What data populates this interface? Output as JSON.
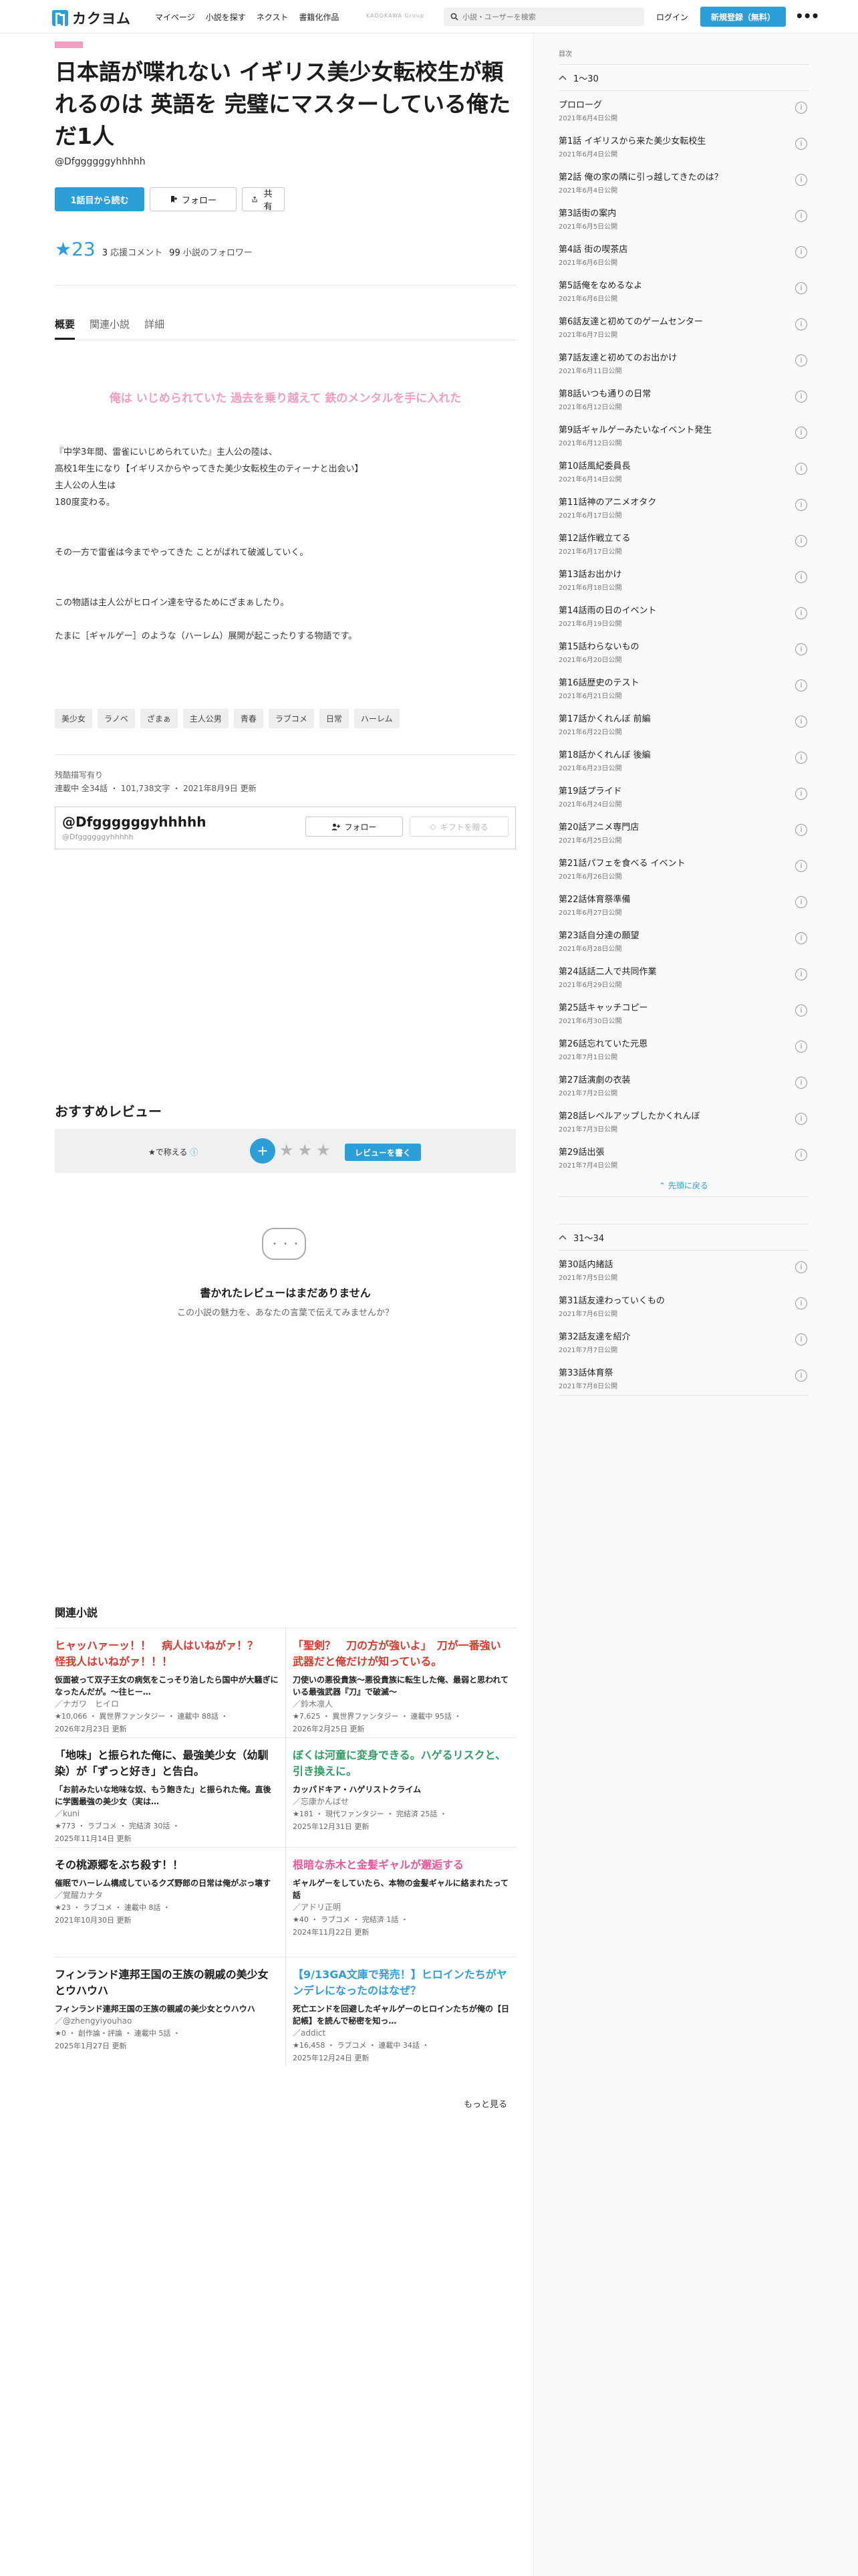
{
  "header": {
    "logo": "カクヨム",
    "nav": [
      "マイページ",
      "小説を探す",
      "ネクスト",
      "書籍化作品"
    ],
    "kadokawa": "KADOKAWA Group",
    "search_placeholder": "小説・ユーザーを検索",
    "login": "ログイン",
    "signup": "新規登録（無料）",
    "more": "•••"
  },
  "work": {
    "title": "日本語が喋れない イギリス美少女転校生が頼れるのは 英語を 完璧にマスターしている俺ただ1人",
    "author": "@Dfggggggyhhhhh",
    "read_button": "1話目から読む",
    "follow_button": "フォロー",
    "share_button": "共有",
    "stars": "★23",
    "comments": "3",
    "comments_label": "応援コメント",
    "followers": "99",
    "followers_label": "小説のフォロワー"
  },
  "tabs": [
    "概要",
    "関連小説",
    "詳細"
  ],
  "catchphrase": "俺は いじめられていた 過去を乗り越えて 鉄のメンタルを手に入れた",
  "introduction": "『中学3年間、雷雀にいじめられていた』主人公の陸は、\n高校1年生になり【イギリスからやってきた美少女転校生のティーナと出会い】\n主人公の人生は\n180度変わる。\n\n\nその一方で雷雀は今までやってきた ことがばれて破滅していく。\n\n\nこの物語は主人公がヒロイン達を守るためにざまぁしたり。\n\nたまに［ギャルゲー］のような（ハーレム）展開が起こったりする物語です。",
  "tags": [
    "美少女",
    "ラノベ",
    "ざまぁ",
    "主人公男",
    "青春",
    "ラブコメ",
    "日常",
    "ハーレム"
  ],
  "meta": {
    "rating_note": "残酷描写有り",
    "status": "連載中 全34話 ・ 101,738文字 ・ 2021年8月9日 更新"
  },
  "author_card": {
    "name": "@Dfggggggyhhhhh",
    "handle": "@Dfggggggyhhhhh",
    "follow": "フォロー",
    "gift": "ギフトを贈る"
  },
  "reviews": {
    "title": "おすすめレビュー",
    "rate_label": "★で称える",
    "plus": "+",
    "stars": [
      "★",
      "★",
      "★"
    ],
    "write": "レビューを書く",
    "empty_title": "書かれたレビューはまだありません",
    "empty_sub": "この小説の魅力を、あなたの言葉で伝えてみませんか？"
  },
  "related": {
    "title": "関連小説",
    "items": [
      {
        "title": "ヒャッハァーッ！！　病人はいねがァ！？　怪我人はいねがァ！！！",
        "color": "#e0352b",
        "desc": "仮面被って双子王女の病気をこっそり治したら国中が大騒ぎになったんだが。〜往ヒー…",
        "author": "／ナガワ　ヒイロ",
        "meta1": "★10,066 ・ 異世界ファンタジー ・ 連載中 88話 ・",
        "meta2": "2026年2月23日 更新"
      },
      {
        "title": "「聖剣？　刀の方が強いよ」　刀が一番強い武器だと俺だけが知っている。",
        "color": "#e0352b",
        "desc": "刀使いの悪役貴族〜悪役貴族に転生した俺、最弱と思われている最強武器『刀』で破滅〜",
        "author": "／鈴木凛人",
        "meta1": "★7,625 ・ 異世界ファンタジー ・ 連載中 95話 ・",
        "meta2": "2026年2月25日 更新"
      },
      {
        "title": "「地味」と振られた俺に、最強美少女（幼馴染）が「ずっと好き」と告白。",
        "color": "#1c1c1c",
        "desc": "「お前みたいな地味な奴、もう飽きた」と振られた俺。直後に学園最強の美少女（実は…",
        "author": "／kuni",
        "meta1": "★773 ・ ラブコメ ・ 完結済 30話 ・",
        "meta2": "2025年11月14日 更新"
      },
      {
        "title": "ぼくは河童に変身できる。ハゲるリスクと、引き換えに。",
        "color": "#2e9d62",
        "desc": "カッパドキア・ハゲリストクライム",
        "author": "／忘康かんばせ",
        "meta1": "★181 ・ 現代ファンタジー ・ 完結済 25話 ・",
        "meta2": "2025年12月31日 更新"
      },
      {
        "title": "その桃源郷をぶち殺す！！",
        "color": "#1c1c1c",
        "desc": "催眠でハーレム構成しているクズ野郎の日常は俺がぶっ壊す",
        "author": "／覚醒カナタ",
        "meta1": "★23 ・ ラブコメ ・ 連載中 8話 ・",
        "meta2": "2021年10月30日 更新"
      },
      {
        "title": "根暗な赤木と金髪ギャルが邂逅する",
        "color": "#e8579a",
        "desc": "ギャルゲーをしていたら、本物の金髪ギャルに絡まれたって話",
        "author": "／アドリ正明",
        "meta1": "★40 ・ ラブコメ ・ 完結済 1話 ・",
        "meta2": "2024年11月22日 更新"
      },
      {
        "title": "フィンランド連邦王国の王族の親戚の美少女とウハウハ",
        "color": "#1c1c1c",
        "desc": "フィンランド連邦王国の王族の親戚の美少女とウハウハ",
        "author": "／@zhengyiyouhao",
        "meta1": "★0 ・ 創作論・評論 ・ 連載中 5話 ・",
        "meta2": "2025年1月27日 更新"
      },
      {
        "title": "【9/13GA文庫で発売！】ヒロインたちがヤンデレになったのはなぜ？",
        "color": "#2c9fd9",
        "desc": "死亡エンドを回避したギャルゲーのヒロインたちが俺の【日記帳】を読んで秘密を知っ…",
        "author": "／addict",
        "meta1": "★16,458 ・ ラブコメ ・ 連載中 34話 ・",
        "meta2": "2025年12月24日 更新"
      }
    ],
    "more": "もっと見る"
  },
  "toc": {
    "label": "目次",
    "section1_title": "1〜30",
    "section1": [
      {
        "t": "プロローグ",
        "d": "2021年6月4日公開"
      },
      {
        "t": "第1話 イギリスから来た美少女転校生",
        "d": "2021年6月4日公開"
      },
      {
        "t": "第2話 俺の家の隣に引っ越してきたのは？",
        "d": "2021年6月4日公開"
      },
      {
        "t": "第3話街の案内",
        "d": "2021年6月5日公開"
      },
      {
        "t": "第4話 街の喫茶店",
        "d": "2021年6月6日公開"
      },
      {
        "t": "第5話俺をなめるなよ",
        "d": "2021年6月6日公開"
      },
      {
        "t": "第6話友達と初めてのゲームセンター",
        "d": "2021年6月7日公開"
      },
      {
        "t": "第7話友達と初めてのお出かけ",
        "d": "2021年6月11日公開"
      },
      {
        "t": "第8話いつも通りの日常",
        "d": "2021年6月12日公開"
      },
      {
        "t": "第9話ギャルゲーみたいなイベント発生",
        "d": "2021年6月12日公開"
      },
      {
        "t": "第10話風紀委員長",
        "d": "2021年6月14日公開"
      },
      {
        "t": "第11話神のアニメオタク",
        "d": "2021年6月17日公開"
      },
      {
        "t": "第12話作戦立てる",
        "d": "2021年6月17日公開"
      },
      {
        "t": "第13話お出かけ",
        "d": "2021年6月18日公開"
      },
      {
        "t": "第14話雨の日のイベント",
        "d": "2021年6月19日公開"
      },
      {
        "t": "第15話わらないもの",
        "d": "2021年6月20日公開"
      },
      {
        "t": "第16話歴史のテスト",
        "d": "2021年6月21日公開"
      },
      {
        "t": "第17話かくれんぼ 前編",
        "d": "2021年6月22日公開"
      },
      {
        "t": "第18話かくれんぼ 後編",
        "d": "2021年6月23日公開"
      },
      {
        "t": "第19話プライド",
        "d": "2021年6月24日公開"
      },
      {
        "t": "第20話アニメ専門店",
        "d": "2021年6月25日公開"
      },
      {
        "t": "第21話パフェを食べる イベント",
        "d": "2021年6月26日公開"
      },
      {
        "t": "第22話体育祭準備",
        "d": "2021年6月27日公開"
      },
      {
        "t": "第23話自分達の願望",
        "d": "2021年6月28日公開"
      },
      {
        "t": "第24話話二人で共同作業",
        "d": "2021年6月29日公開"
      },
      {
        "t": "第25話キャッチコピー",
        "d": "2021年6月30日公開"
      },
      {
        "t": "第26話忘れていた元恩",
        "d": "2021年7月1日公開"
      },
      {
        "t": "第27話演劇の衣装",
        "d": "2021年7月2日公開"
      },
      {
        "t": "第28話レベルアップしたかくれんぼ",
        "d": "2021年7月3日公開"
      },
      {
        "t": "第29話出張",
        "d": "2021年7月4日公開"
      }
    ],
    "collapse": "先頭に戻る",
    "section2_title": "31〜34",
    "section2": [
      {
        "t": "第30話内緒話",
        "d": "2021年7月5日公開"
      },
      {
        "t": "第31話友達わっていくもの",
        "d": "2021年7月6日公開"
      },
      {
        "t": "第32話友達を紹介",
        "d": "2021年7月7日公開"
      },
      {
        "t": "第33話体育祭",
        "d": "2021年7月8日公開"
      }
    ]
  }
}
